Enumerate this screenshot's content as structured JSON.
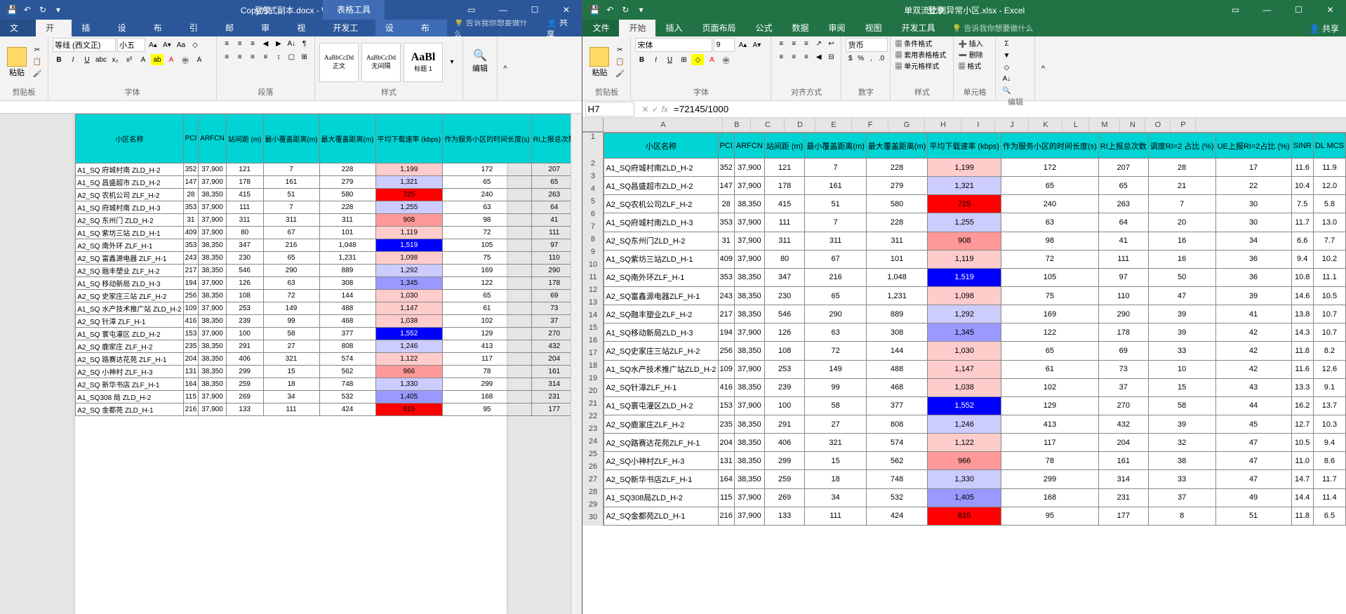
{
  "word": {
    "title": "Copy方式副本.docx - Word",
    "table_tools": "表格工具",
    "login": "登录",
    "tabs": {
      "file": "文件",
      "home": "开始",
      "insert": "插入",
      "design": "设计",
      "layout": "布局",
      "references": "引用",
      "mail": "邮件",
      "review": "审阅",
      "view": "视图",
      "dev": "开发工具",
      "ctx_design": "设计",
      "ctx_layout": "布局"
    },
    "search": "告诉我你想要做什么",
    "share": "共享",
    "groups": {
      "clipboard": "剪贴板",
      "font": "字体",
      "paragraph": "段落",
      "styles": "样式",
      "editing": "编辑"
    },
    "paste": "粘贴",
    "font_name": "等线 (西文正)",
    "font_size": "小五",
    "styles": {
      "normal": "正文",
      "nospacing": "无间隔",
      "heading1": "标题 1"
    },
    "style_preview": "AaBbCcDd"
  },
  "excel": {
    "title": "单双流比例异常小区.xlsx - Excel",
    "login": "登录",
    "tabs": {
      "file": "文件",
      "home": "开始",
      "insert": "插入",
      "pagelayout": "页面布局",
      "formulas": "公式",
      "data": "数据",
      "review": "审阅",
      "view": "视图",
      "dev": "开发工具"
    },
    "search": "告诉我你想要做什么",
    "share": "共享",
    "groups": {
      "clipboard": "剪贴板",
      "font": "字体",
      "alignment": "对齐方式",
      "number": "数字",
      "styles": "样式",
      "cells": "单元格",
      "editing": "编辑"
    },
    "paste": "粘贴",
    "font_name": "宋体",
    "font_size": "9",
    "number_format": "货币",
    "cond_format": "条件格式",
    "table_format": "套用表格格式",
    "cell_styles": "单元格样式",
    "insert_btn": "插入",
    "delete_btn": "删除",
    "format_btn": "格式",
    "namebox": "H7",
    "formula": "=72145/1000"
  },
  "columns_letters": [
    "A",
    "B",
    "C",
    "D",
    "E",
    "F",
    "G",
    "H",
    "I",
    "J",
    "K",
    "L",
    "M",
    "N",
    "O",
    "P"
  ],
  "headers": [
    "小区名称",
    "PCI",
    "ARFCN",
    "站间距 (m)",
    "最小覆盖距离(m)",
    "最大覆盖距离(m)",
    "平均下载速率 (kbps)",
    "作为服务小区的时间长度(s)",
    "RI上报总次数",
    "调度RI=2 占比 (%)",
    "UE上报RI=2占比 (%)",
    "SINR",
    "DL MCS"
  ],
  "rows": [
    {
      "d": [
        "A1_SQ 府城村南 ZLD_H-2",
        "352",
        "37,900",
        "121",
        "7",
        "228",
        "1,199",
        "172",
        "207",
        "28",
        "17",
        "11.6",
        "11.9"
      ],
      "hl": {
        "6": "m2"
      }
    },
    {
      "d": [
        "A1_SQ 昌盛超市 ZLD_H-2",
        "147",
        "37,900",
        "178",
        "161",
        "279",
        "1,321",
        "65",
        "65",
        "21",
        "22",
        "10.4",
        "12.0"
      ],
      "hl": {
        "6": "lo"
      }
    },
    {
      "d": [
        "A2_SQ 农机公司 ZLF_H-2",
        "28",
        "38,350",
        "415",
        "51",
        "580",
        "725",
        "240",
        "263",
        "7",
        "30",
        "7.5",
        "5.8"
      ],
      "hl": {
        "6": "max"
      }
    },
    {
      "d": [
        "A1_SQ 府城村南 ZLD_H-3",
        "353",
        "37,900",
        "111",
        "7",
        "228",
        "1,255",
        "63",
        "64",
        "20",
        "30",
        "11.7",
        "13.0"
      ],
      "hl": {
        "6": "lo"
      }
    },
    {
      "d": [
        "A2_SQ 东州门 ZLD_H-2",
        "31",
        "37,900",
        "311",
        "311",
        "311",
        "908",
        "98",
        "41",
        "16",
        "34",
        "6.6",
        "7.7"
      ],
      "hl": {
        "6": "m1"
      }
    },
    {
      "d": [
        "A1_SQ 紫坊三站 ZLD_H-1",
        "409",
        "37,900",
        "80",
        "67",
        "101",
        "1,119",
        "72",
        "111",
        "16",
        "36",
        "9.4",
        "10.2"
      ],
      "hl": {
        "6": "m2"
      }
    },
    {
      "d": [
        "A2_SQ 南外环 ZLF_H-1",
        "353",
        "38,350",
        "347",
        "216",
        "1,048",
        "1,519",
        "105",
        "97",
        "50",
        "36",
        "10.8",
        "11.1"
      ],
      "hl": {
        "6": "min"
      }
    },
    {
      "d": [
        "A2_SQ 富鑫源电器 ZLF_H-1",
        "243",
        "38,350",
        "230",
        "65",
        "1,231",
        "1,098",
        "75",
        "110",
        "47",
        "39",
        "14.6",
        "10.5"
      ],
      "hl": {
        "6": "m2"
      }
    },
    {
      "d": [
        "A2_SQ 融丰塑业 ZLF_H-2",
        "217",
        "38,350",
        "546",
        "290",
        "889",
        "1,292",
        "169",
        "290",
        "39",
        "41",
        "13.8",
        "10.7"
      ],
      "hl": {
        "6": "lo"
      }
    },
    {
      "d": [
        "A1_SQ 移动新局 ZLD_H-3",
        "194",
        "37,900",
        "126",
        "63",
        "308",
        "1,345",
        "122",
        "178",
        "39",
        "42",
        "14.3",
        "10.7"
      ],
      "hl": {
        "6": "l2"
      }
    },
    {
      "d": [
        "A2_SQ 史家庄三站 ZLF_H-2",
        "256",
        "38,350",
        "108",
        "72",
        "144",
        "1,030",
        "65",
        "69",
        "33",
        "42",
        "11.8",
        "8.2"
      ],
      "hl": {
        "6": "m2"
      }
    },
    {
      "d": [
        "A1_SQ 水产技术推广站 ZLD_H-2",
        "109",
        "37,900",
        "253",
        "149",
        "488",
        "1,147",
        "61",
        "73",
        "10",
        "42",
        "11.6",
        "12.6"
      ],
      "hl": {
        "6": "m2"
      }
    },
    {
      "d": [
        "A2_SQ 针漳 ZLF_H-1",
        "416",
        "38,350",
        "239",
        "99",
        "468",
        "1,038",
        "102",
        "37",
        "15",
        "43",
        "13.3",
        "9.1"
      ],
      "hl": {
        "6": "m2"
      }
    },
    {
      "d": [
        "A1_SQ 寰屯灌区 ZLD_H-2",
        "153",
        "37,900",
        "100",
        "58",
        "377",
        "1,552",
        "129",
        "270",
        "58",
        "44",
        "16.2",
        "13.7"
      ],
      "hl": {
        "6": "min"
      }
    },
    {
      "d": [
        "A2_SQ 鹿家庄 ZLF_H-2",
        "235",
        "38,350",
        "291",
        "27",
        "808",
        "1,246",
        "413",
        "432",
        "39",
        "45",
        "12.7",
        "10.3"
      ],
      "hl": {
        "6": "lo"
      }
    },
    {
      "d": [
        "A2_SQ 路赛达花苑 ZLF_H-1",
        "204",
        "38,350",
        "406",
        "321",
        "574",
        "1,122",
        "117",
        "204",
        "32",
        "47",
        "10.5",
        "9.4"
      ],
      "hl": {
        "6": "m2"
      }
    },
    {
      "d": [
        "A2_SQ 小神村 ZLF_H-3",
        "131",
        "38,350",
        "299",
        "15",
        "562",
        "966",
        "78",
        "161",
        "38",
        "47",
        "11.0",
        "8.6"
      ],
      "hl": {
        "6": "m1"
      }
    },
    {
      "d": [
        "A2_SQ 新华书店 ZLF_H-1",
        "164",
        "38,350",
        "259",
        "18",
        "748",
        "1,330",
        "299",
        "314",
        "33",
        "47",
        "14.7",
        "11.7"
      ],
      "hl": {
        "6": "lo"
      }
    },
    {
      "d": [
        "A1_SQ308 局 ZLD_H-2",
        "115",
        "37,900",
        "269",
        "34",
        "532",
        "1,405",
        "168",
        "231",
        "37",
        "49",
        "14.4",
        "11.4"
      ],
      "hl": {
        "6": "l2"
      }
    },
    {
      "d": [
        "A2_SQ 金都苑 ZLD_H-1",
        "216",
        "37,900",
        "133",
        "111",
        "424",
        "815",
        "95",
        "177",
        "8",
        "51",
        "11.8",
        "6.5"
      ],
      "hl": {
        "6": "max"
      }
    }
  ],
  "excel_rows_names": [
    "A1_SQ府城村南ZLD_H-2",
    "A1_SQ昌盛超市ZLD_H-2",
    "A2_SQ农机公司ZLF_H-2",
    "A1_SQ府城村南ZLD_H-3",
    "A2_SQ东州门ZLD_H-2",
    "A1_SQ紫坊三站ZLD_H-1",
    "A2_SQ南外环ZLF_H-1",
    "A2_SQ富鑫源电器ZLF_H-1",
    "A2_SQ融丰塑业ZLF_H-2",
    "A1_SQ移动新局ZLD_H-3",
    "A2_SQ史家庄三站ZLF_H-2",
    "A1_SQ水产技术推广站ZLD_H-2",
    "A2_SQ针漳ZLF_H-1",
    "A1_SQ寰屯灌区ZLD_H-2",
    "A2_SQ鹿家庄ZLF_H-2",
    "A2_SQ路赛达花苑ZLF_H-1",
    "A2_SQ小神村ZLF_H-3",
    "A2_SQ新华书店ZLF_H-1",
    "A1_SQ308局ZLD_H-2",
    "A2_SQ金都苑ZLD_H-1"
  ]
}
